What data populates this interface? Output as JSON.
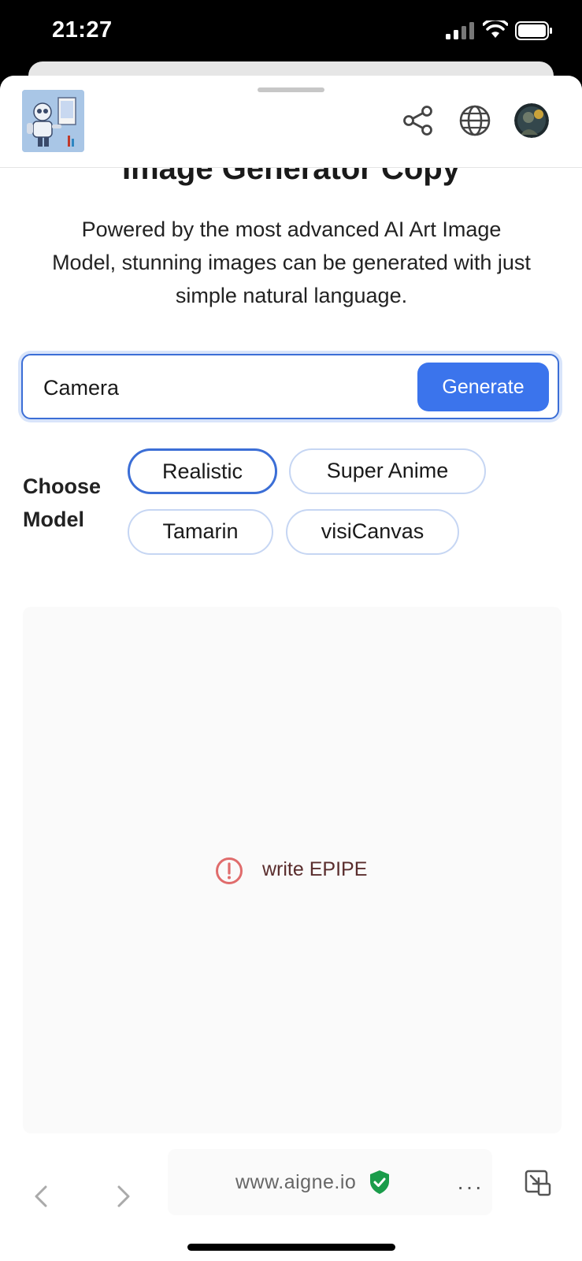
{
  "status_bar": {
    "time": "21:27"
  },
  "header": {
    "logo_alt": "robot-painter-logo",
    "share_icon": "share-icon",
    "globe_icon": "globe-icon",
    "avatar_icon": "avatar"
  },
  "main": {
    "title": "Image Generator Copy",
    "description": "Powered by the most advanced AI Art Image Model, stunning images can be generated with just simple natural language.",
    "prompt": {
      "value": "Camera",
      "placeholder": ""
    },
    "generate_label": "Generate",
    "choose_model_label": "Choose Model",
    "models": [
      {
        "label": "Realistic",
        "selected": true
      },
      {
        "label": "Super Anime",
        "selected": false
      },
      {
        "label": "Tamarin",
        "selected": false
      },
      {
        "label": "visiCanvas",
        "selected": false
      }
    ],
    "error_message": "write EPIPE"
  },
  "browser": {
    "url": "www.aigne.io",
    "more_label": "···"
  },
  "colors": {
    "accent": "#3b74ec",
    "selected_border": "#3b6ed6",
    "error": "#e06c6c",
    "secure": "#1a9c4a"
  }
}
